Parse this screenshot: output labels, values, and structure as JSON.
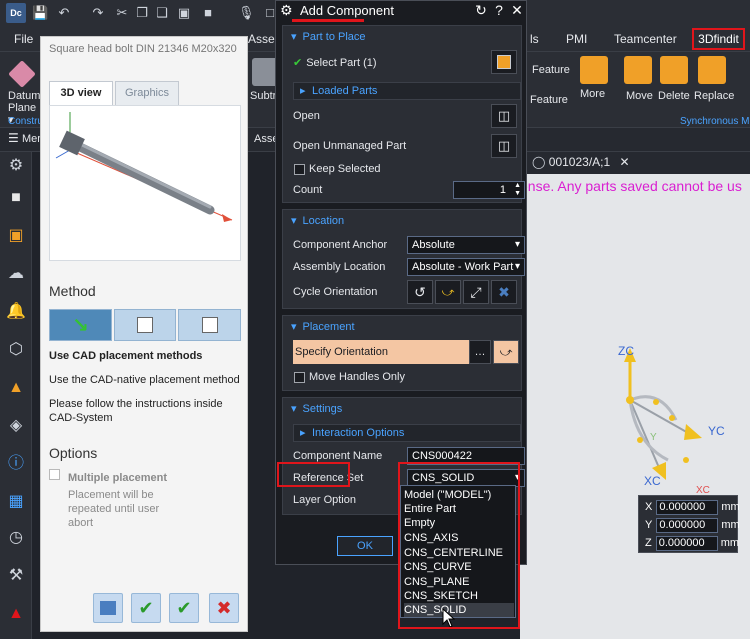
{
  "app": {
    "icon_text": "Dc"
  },
  "menubar": {
    "items": [
      "File",
      "Asse",
      "ls",
      "PMI",
      "Teamcenter",
      "3Dfindit"
    ]
  },
  "ribbon": {
    "datum_plane_label": "Datum Plane ▾",
    "constr_group": "Constru",
    "subtr_label": "Subtr",
    "feature_label_1": "Feature",
    "feature_label_2": "Feature",
    "more_label": "More",
    "move_label": "Move",
    "delete_label": "Delete",
    "replace_label": "Replace",
    "sync_group": "Synchronous M"
  },
  "subbar": {
    "menu_label": "Men",
    "asse_label": "Asse"
  },
  "file_tab": {
    "label": "001023/A;1"
  },
  "license_text": "ense. Any parts saved cannot be us",
  "side_panel": {
    "title": "Square head bolt DIN 21346 M20x320",
    "tab_3d": "3D view",
    "tab_graphics": "Graphics",
    "method_heading": "Method",
    "method_title": "Use CAD placement methods",
    "method_desc": "Use the CAD-native placement method",
    "instructions": "Please follow the instructions inside CAD-System",
    "options_heading": "Options",
    "multiple_placement": "Multiple placement",
    "multiple_placement_desc": "Placement will be repeated until user abort"
  },
  "dialog": {
    "title": "Add Component",
    "part_to_place": {
      "header": "Part to Place",
      "select_part": "Select Part (1)",
      "loaded_parts": "Loaded Parts",
      "open": "Open",
      "open_unmanaged": "Open Unmanaged Part",
      "keep_selected": "Keep Selected",
      "count_label": "Count",
      "count_value": "1"
    },
    "location": {
      "header": "Location",
      "anchor_label": "Component Anchor",
      "anchor_value": "Absolute",
      "assembly_location_label": "Assembly Location",
      "assembly_location_value": "Absolute - Work Part",
      "cycle_label": "Cycle Orientation"
    },
    "placement": {
      "header": "Placement",
      "specify_orientation": "Specify Orientation",
      "move_handles_only": "Move Handles Only"
    },
    "settings": {
      "header": "Settings",
      "interaction_options": "Interaction Options",
      "component_name_label": "Component Name",
      "component_name_value": "CNS000422",
      "reference_set_label": "Reference Set",
      "reference_set_value": "CNS_SOLID",
      "layer_option_label": "Layer Option"
    },
    "ok_label": "OK",
    "reference_set_options": [
      "Model (\"MODEL\")",
      "Entire Part",
      "Empty",
      "CNS_AXIS",
      "CNS_CENTERLINE",
      "CNS_CURVE",
      "CNS_PLANE",
      "CNS_SKETCH",
      "CNS_SOLID"
    ]
  },
  "viewport": {
    "axis_zc": "ZC",
    "axis_yc": "YC",
    "axis_xc": "XC",
    "axis_y_small": "Y",
    "axis_xc_small": "XC",
    "coord_x_label": "X",
    "coord_y_label": "Y",
    "coord_z_label": "Z",
    "coord_x": "0.000000",
    "coord_y": "0.000000",
    "coord_z": "0.000000",
    "unit": "mm"
  },
  "colors": {
    "accent_blue": "#4aa3ff",
    "highlight_red": "#e0151b",
    "orientation_fill": "#f4c6a3",
    "license_magenta": "#d91fd1"
  }
}
